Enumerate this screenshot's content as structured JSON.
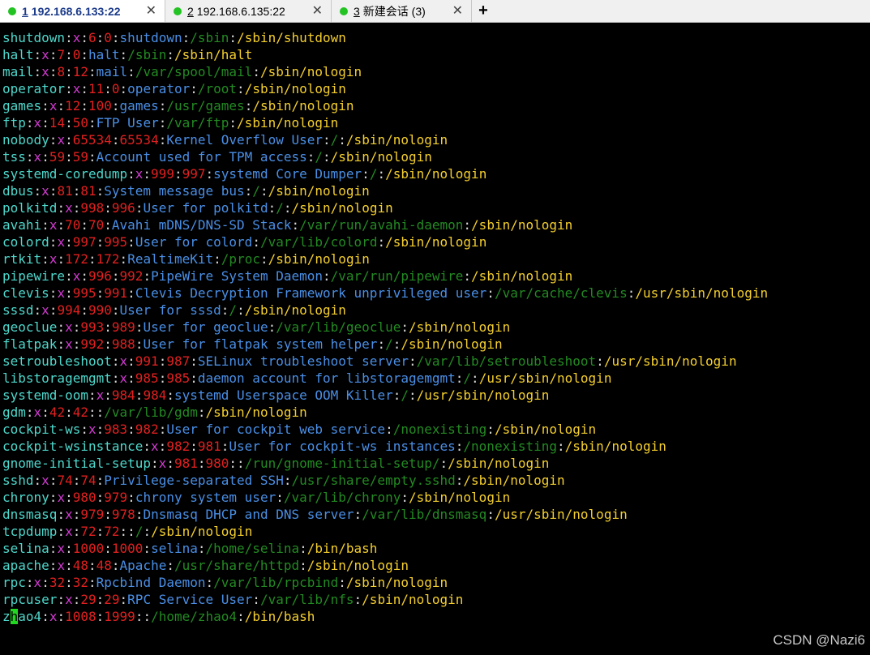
{
  "tabs": [
    {
      "num": "1",
      "label": "192.168.6.133:22",
      "active": true
    },
    {
      "num": "2",
      "label": "192.168.6.135:22",
      "active": false
    },
    {
      "num": "3",
      "label": "新建会话 (3)",
      "active": false
    }
  ],
  "tab_close_glyph": "✕",
  "add_tab_glyph": "+",
  "cursor_char": "h",
  "watermark": "CSDN @Nazi6",
  "colors": {
    "username": "#4ed8cc",
    "password_field": "#d23ad2",
    "ids": "#e22020",
    "gecos": "#4a8fe6",
    "home": "#238a23",
    "shell": "#f4cf2e",
    "cursor": "#22d622"
  },
  "passwd_lines": [
    [
      "shutdown",
      "x",
      "6",
      "0",
      "shutdown",
      "/sbin",
      "/sbin/shutdown"
    ],
    [
      "halt",
      "x",
      "7",
      "0",
      "halt",
      "/sbin",
      "/sbin/halt"
    ],
    [
      "mail",
      "x",
      "8",
      "12",
      "mail",
      "/var/spool/mail",
      "/sbin/nologin"
    ],
    [
      "operator",
      "x",
      "11",
      "0",
      "operator",
      "/root",
      "/sbin/nologin"
    ],
    [
      "games",
      "x",
      "12",
      "100",
      "games",
      "/usr/games",
      "/sbin/nologin"
    ],
    [
      "ftp",
      "x",
      "14",
      "50",
      "FTP User",
      "/var/ftp",
      "/sbin/nologin"
    ],
    [
      "nobody",
      "x",
      "65534",
      "65534",
      "Kernel Overflow User",
      "/",
      "/sbin/nologin"
    ],
    [
      "tss",
      "x",
      "59",
      "59",
      "Account used for TPM access",
      "/",
      "/sbin/nologin"
    ],
    [
      "systemd-coredump",
      "x",
      "999",
      "997",
      "systemd Core Dumper",
      "/",
      "/sbin/nologin"
    ],
    [
      "dbus",
      "x",
      "81",
      "81",
      "System message bus",
      "/",
      "/sbin/nologin"
    ],
    [
      "polkitd",
      "x",
      "998",
      "996",
      "User for polkitd",
      "/",
      "/sbin/nologin"
    ],
    [
      "avahi",
      "x",
      "70",
      "70",
      "Avahi mDNS/DNS-SD Stack",
      "/var/run/avahi-daemon",
      "/sbin/nologin"
    ],
    [
      "colord",
      "x",
      "997",
      "995",
      "User for colord",
      "/var/lib/colord",
      "/sbin/nologin"
    ],
    [
      "rtkit",
      "x",
      "172",
      "172",
      "RealtimeKit",
      "/proc",
      "/sbin/nologin"
    ],
    [
      "pipewire",
      "x",
      "996",
      "992",
      "PipeWire System Daemon",
      "/var/run/pipewire",
      "/sbin/nologin"
    ],
    [
      "clevis",
      "x",
      "995",
      "991",
      "Clevis Decryption Framework unprivileged user",
      "/var/cache/clevis",
      "/usr/sbin/nologin"
    ],
    [
      "sssd",
      "x",
      "994",
      "990",
      "User for sssd",
      "/",
      "/sbin/nologin"
    ],
    [
      "geoclue",
      "x",
      "993",
      "989",
      "User for geoclue",
      "/var/lib/geoclue",
      "/sbin/nologin"
    ],
    [
      "flatpak",
      "x",
      "992",
      "988",
      "User for flatpak system helper",
      "/",
      "/sbin/nologin"
    ],
    [
      "setroubleshoot",
      "x",
      "991",
      "987",
      "SELinux troubleshoot server",
      "/var/lib/setroubleshoot",
      "/usr/sbin/nologin"
    ],
    [
      "libstoragemgmt",
      "x",
      "985",
      "985",
      "daemon account for libstoragemgmt",
      "/",
      "/usr/sbin/nologin"
    ],
    [
      "systemd-oom",
      "x",
      "984",
      "984",
      "systemd Userspace OOM Killer",
      "/",
      "/usr/sbin/nologin"
    ],
    [
      "gdm",
      "x",
      "42",
      "42",
      "",
      "/var/lib/gdm",
      "/sbin/nologin"
    ],
    [
      "cockpit-ws",
      "x",
      "983",
      "982",
      "User for cockpit web service",
      "/nonexisting",
      "/sbin/nologin"
    ],
    [
      "cockpit-wsinstance",
      "x",
      "982",
      "981",
      "User for cockpit-ws instances",
      "/nonexisting",
      "/sbin/nologin"
    ],
    [
      "gnome-initial-setup",
      "x",
      "981",
      "980",
      "",
      "/run/gnome-initial-setup/",
      "/sbin/nologin"
    ],
    [
      "sshd",
      "x",
      "74",
      "74",
      "Privilege-separated SSH",
      "/usr/share/empty.sshd",
      "/sbin/nologin"
    ],
    [
      "chrony",
      "x",
      "980",
      "979",
      "chrony system user",
      "/var/lib/chrony",
      "/sbin/nologin"
    ],
    [
      "dnsmasq",
      "x",
      "979",
      "978",
      "Dnsmasq DHCP and DNS server",
      "/var/lib/dnsmasq",
      "/usr/sbin/nologin"
    ],
    [
      "tcpdump",
      "x",
      "72",
      "72",
      "",
      "/",
      "/sbin/nologin"
    ],
    [
      "selina",
      "x",
      "1000",
      "1000",
      "selina",
      "/home/selina",
      "/bin/bash"
    ],
    [
      "apache",
      "x",
      "48",
      "48",
      "Apache",
      "/usr/share/httpd",
      "/sbin/nologin"
    ],
    [
      "rpc",
      "x",
      "32",
      "32",
      "Rpcbind Daemon",
      "/var/lib/rpcbind",
      "/sbin/nologin"
    ],
    [
      "rpcuser",
      "x",
      "29",
      "29",
      "RPC Service User",
      "/var/lib/nfs",
      "/sbin/nologin"
    ],
    [
      "zhao4",
      "x",
      "1008",
      "1999",
      "",
      "/home/zhao4",
      "/bin/bash"
    ]
  ]
}
